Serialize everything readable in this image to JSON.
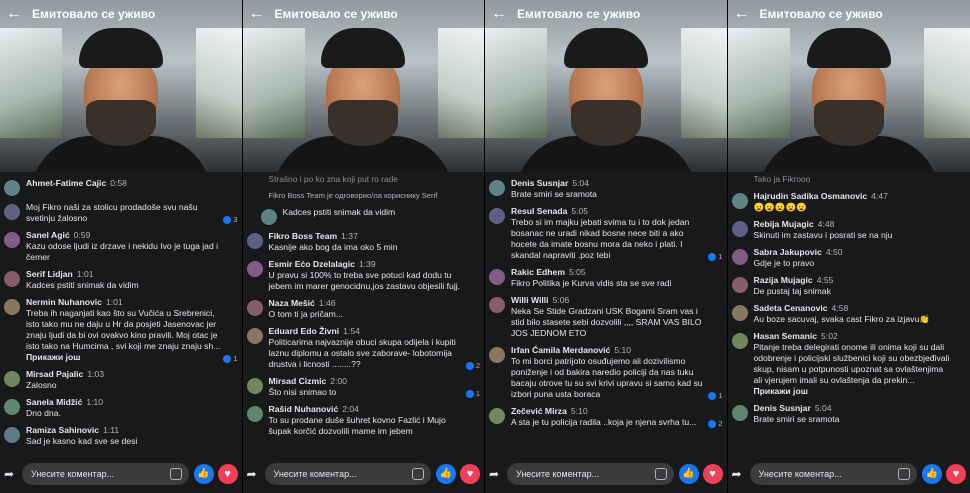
{
  "title": "Емитовало се уживо",
  "input_placeholder": "Унесите коментар...",
  "panel1": {
    "comments": [
      {
        "name": "Ahmet-Fatime Cajic",
        "time": "0:58",
        "text": "",
        "faded": true
      },
      {
        "name": "",
        "time": "",
        "text": "Moj Fikro naši za stolicu prodadoše svu našu svetinju žalosno",
        "reacts": "3"
      },
      {
        "name": "Sanel Agić",
        "time": "0:59",
        "text": "Kazu odose ljudi iz drzave i nekidu Ivo je tuga jad i čemer"
      },
      {
        "name": "Serif Lidjan",
        "time": "1:01",
        "text": "Kadces pstiti snimak da vidim"
      },
      {
        "name": "Nermin Nuhanovic",
        "time": "1:01",
        "text": "Treba ih naganjati kao što su Vučića u Srebrenici, isto tako mu ne daju u Hr da posjeti Jasenovac jer znaju ljudi da bi ovi ovakvo kino pravili. Moj otac je isto tako na Humcima , svi koji me znaju znaju sh...",
        "more": "Прикажи још",
        "reacts": "1"
      },
      {
        "name": "Mirsad Pajalic",
        "time": "1:03",
        "text": "Zalosno"
      },
      {
        "name": "Sanela Midžić",
        "time": "1:10",
        "text": "Dno dna."
      },
      {
        "name": "Ramiza Sahinovic",
        "time": "1:11",
        "text": "Sad je kasno kad sve se desi"
      }
    ]
  },
  "panel2": {
    "top_text": "Strašno i po ko zna koji put ro rade",
    "reply_tag": "Fikro Boss Team је одговорио/ла кориснику Serif",
    "comments": [
      {
        "name": "",
        "time": "",
        "text": "Kadces pstiti snimak da vidim",
        "indent": true
      },
      {
        "name": "Fikro Boss Team",
        "time": "1:37",
        "text": "Kasnije ako bog da ima oko 5 min"
      },
      {
        "name": "Esmir Ećo Dzelalagic",
        "time": "1:39",
        "text": "U pravu si 100% to treba sve potuci kad dodu tu jebem im marer genocidnu,jos zastavu objesili  fujj."
      },
      {
        "name": "Naza Mešić",
        "time": "1:46",
        "text": "O tom ti ja pričam..."
      },
      {
        "name": "Eduard Edo Živni",
        "time": "1:54",
        "text": "Politicarima najvaznije obuci skupa odijela i kupiti laznu diplomu a ostalo sve zaborave- lobotomija drustva i licnosti ........??",
        "reacts": "2"
      },
      {
        "name": "Mirsad Cizmic",
        "time": "2:00",
        "text": "Što nisi snimao to",
        "reacts": "1"
      },
      {
        "name": "Rašid Nuhanović",
        "time": "2:04",
        "text": "To su prodane duše šuhret kovno Fazlić i Mujo šupak korčić dozvolili mame im jebem"
      }
    ]
  },
  "panel3": {
    "comments": [
      {
        "name": "Denis Susnjar",
        "time": "5:04",
        "text": "Brate smiri se sramota"
      },
      {
        "name": "Resul Senada",
        "time": "5:05",
        "text": "Trebo si im majku jebati svima tu i to dok jedan bosanac ne uradi nikad bosne nece biti a ako hocete da imate bosnu mora da neko i plati. I skandal napraviti .poz tebi",
        "reacts": "1"
      },
      {
        "name": "Rakic Edhem",
        "time": "5:05",
        "text": "Fikro Politika je Kurva vidis sta se sve radi"
      },
      {
        "name": "Willi Willi",
        "time": "5:06",
        "text": "Neka Se Stide Gradzani USK Bogami Sram vas i stid bilo stasete sebi dozvolili ,,,, SRAM VAS BILO JOS JEDNOM ETO"
      },
      {
        "name": "Irfan Ćamila Merdanović",
        "time": "5:10",
        "text": "To mi borci patrijoto osuđujemo ali dozivilismo poniženje i od bakira naredio policiji da nas tuku bacaju otrove tu su svi krivi upravu si samo kad su izbori puna usta boraca",
        "reacts": "1"
      },
      {
        "name": "Zečević Mirza",
        "time": "5:10",
        "text": "A sta je tu policija radila ..koja je njena svrha tu...",
        "reacts": "2"
      }
    ]
  },
  "panel4": {
    "top_text": "Tako ja Fikrooo",
    "comments": [
      {
        "name": "Hajrudin Sadika Osmanovic",
        "time": "4:47",
        "text": "😦😦😦😦😦"
      },
      {
        "name": "Rebija Mujagic",
        "time": "4:48",
        "text": "Skinuti im zastavu i posrati se na nju"
      },
      {
        "name": "Sabra Jakupovic",
        "time": "4:50",
        "text": "Gdje je to pravo"
      },
      {
        "name": "Razija Mujagic",
        "time": "4:55",
        "text": "De pustaj taj snimak"
      },
      {
        "name": "Sadeta Cenanovic",
        "time": "4:58",
        "text": "Au boze sacuvaj, svaka cast Fikro za izjavu👏"
      },
      {
        "name": "Hasan Semanic",
        "time": "5:02",
        "text": "Pitanje treba delegirati onome ili onima koji su dali odobrenje i policijski službenici koji su obezbjeđivali skup, nisam u potpunosti upoznat sa ovlaštenjima ali vjerujem imali su ovlaštenja da prekin...",
        "more": "Прикажи још"
      },
      {
        "name": "Denis Susnjar",
        "time": "5:04",
        "text": "Brate smiri se sramota"
      }
    ]
  }
}
